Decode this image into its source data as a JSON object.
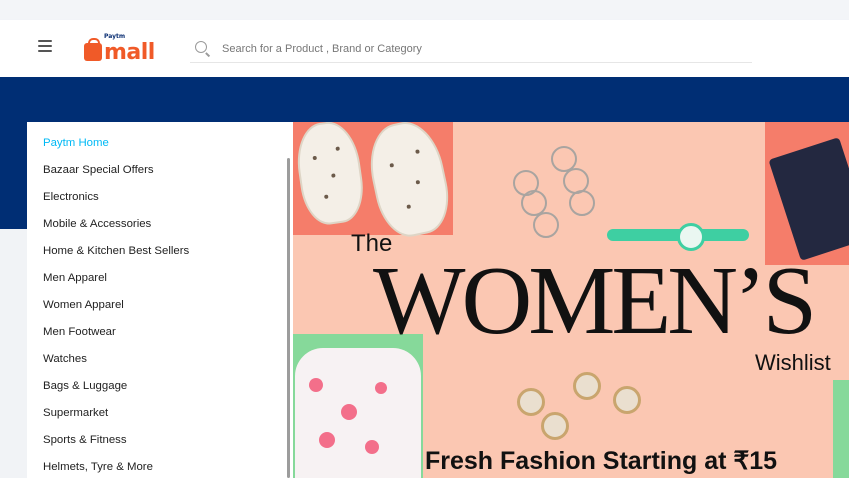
{
  "header": {
    "logo_prefix": "Paytm",
    "logo_text": "mall",
    "search_placeholder": "Search for a Product , Brand or Category"
  },
  "menu": {
    "items": [
      {
        "label": "Paytm Home",
        "active": true
      },
      {
        "label": "Bazaar Special Offers"
      },
      {
        "label": "Electronics"
      },
      {
        "label": "Mobile & Accessories"
      },
      {
        "label": "Home & Kitchen Best Sellers"
      },
      {
        "label": "Men Apparel"
      },
      {
        "label": "Women Apparel"
      },
      {
        "label": "Men Footwear"
      },
      {
        "label": "Watches"
      },
      {
        "label": "Bags & Luggage"
      },
      {
        "label": "Supermarket"
      },
      {
        "label": "Sports & Fitness"
      },
      {
        "label": "Helmets, Tyre & More"
      }
    ]
  },
  "banner": {
    "title_small": "The",
    "title_big": "WOMEN’S",
    "subtitle": "Wishlist",
    "offer": "Fresh Fashion Starting at ₹15"
  },
  "colors": {
    "brand_orange": "#f05a28",
    "brand_blue": "#002e74",
    "link_blue": "#00b9f5",
    "banner_peach": "#fbc7b2",
    "banner_coral": "#f57d6a",
    "banner_green": "#86d99a"
  }
}
